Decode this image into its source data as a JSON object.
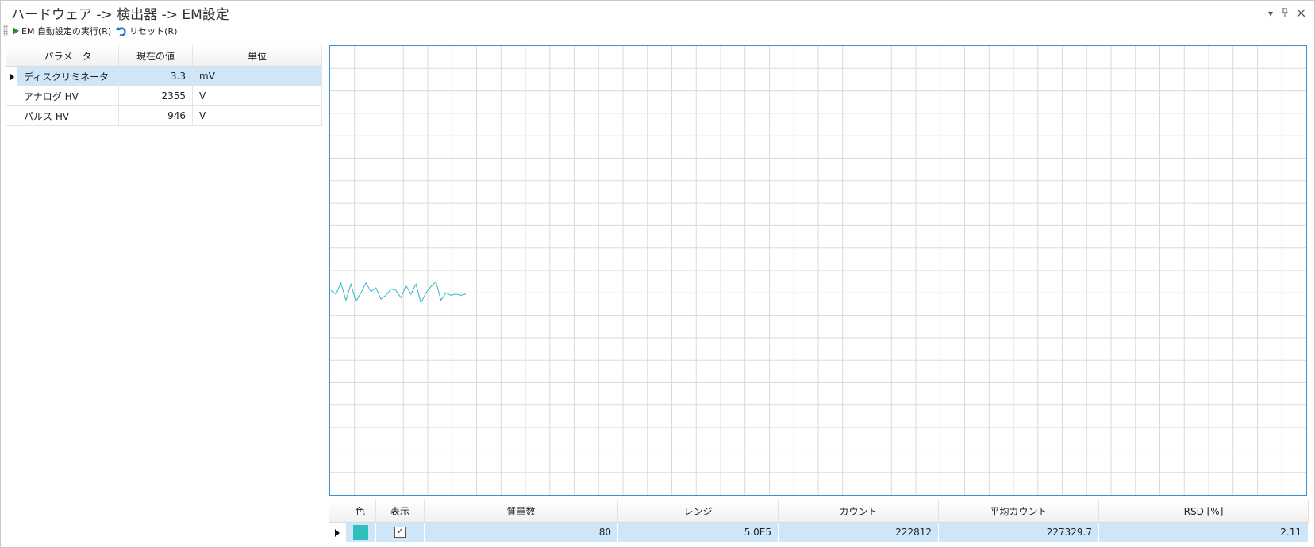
{
  "window": {
    "title": "ハードウェア -> 検出器 -> EM設定"
  },
  "toolbar": {
    "run_label": "EM 自動設定の実行(R)",
    "reset_label": "リセット(R)"
  },
  "params": {
    "headers": [
      "パラメータ",
      "現在の値",
      "単位"
    ],
    "rows": [
      {
        "name": "ディスクリミネータ",
        "value": "3.3",
        "unit": "mV"
      },
      {
        "name": "アナログ HV",
        "value": "2355",
        "unit": "V"
      },
      {
        "name": "パルス HV",
        "value": "946",
        "unit": "V"
      }
    ]
  },
  "chart_data": {
    "type": "line",
    "title": "",
    "xlabel": "",
    "ylabel": "",
    "grid": true,
    "x": [
      0,
      1,
      2,
      3,
      4,
      5,
      6,
      7,
      8,
      9,
      10,
      11,
      12,
      13,
      14,
      15,
      16,
      17,
      18,
      19,
      20,
      21,
      22,
      23,
      24,
      25,
      26,
      27
    ],
    "series": [
      {
        "color": "#33b5c8",
        "values": [
          6.4,
          6.1,
          7.0,
          5.6,
          6.9,
          5.5,
          6.2,
          7.0,
          6.3,
          6.6,
          5.7,
          6.0,
          6.5,
          6.4,
          5.8,
          6.8,
          6.1,
          6.9,
          5.4,
          6.2,
          6.7,
          7.1,
          5.6,
          6.2,
          6.0,
          6.1,
          6.0,
          6.1
        ]
      }
    ]
  },
  "mass_table": {
    "headers": [
      "色",
      "表示",
      "質量数",
      "レンジ",
      "カウント",
      "平均カウント",
      "RSD [%]"
    ],
    "row": {
      "color": "#2fbfbf",
      "checked": "✓",
      "mass": "80",
      "range": "5.0E5",
      "count": "222812",
      "avg": "227329.7",
      "rsd": "2.11"
    }
  }
}
